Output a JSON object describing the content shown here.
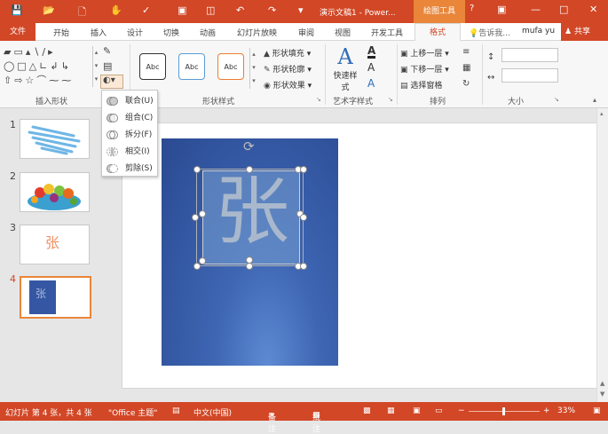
{
  "titlebar": {
    "title": "演示文稿1 - Power...",
    "contextual_tab": "绘图工具",
    "help": "?"
  },
  "tabs": {
    "file": "文件",
    "items": [
      "开始",
      "插入",
      "设计",
      "切换",
      "动画",
      "幻灯片放映",
      "审阅",
      "视图",
      "开发工具"
    ],
    "active": "格式",
    "tell_me": "告诉我...",
    "user": "mufa yu",
    "share": "共享"
  },
  "ribbon": {
    "groups": {
      "insert_shapes": "插入形状",
      "shape_styles": "形状样式",
      "wordart": "艺术字样式",
      "arrange": "排列",
      "size": "大小"
    },
    "style_samples": [
      "Abc",
      "Abc",
      "Abc"
    ],
    "shape_fill": "形状填充",
    "shape_outline": "形状轮廓",
    "shape_effects": "形状效果",
    "quick_styles": "快速样式",
    "bring_forward": "上移一层",
    "send_backward": "下移一层",
    "selection_pane": "选择窗格",
    "wordart_letter": "A"
  },
  "merge_menu": {
    "items": [
      "联合(U)",
      "组合(C)",
      "拆分(F)",
      "相交(I)",
      "剪除(S)"
    ]
  },
  "slides": {
    "numbers": [
      "1",
      "2",
      "3",
      "4"
    ],
    "thumb3_char": "张",
    "thumb4_char": "张"
  },
  "slide": {
    "text": "张"
  },
  "statusbar": {
    "slide_info": "幻灯片 第 4 张，共 4 张",
    "theme": "\"Office 主题\"",
    "language": "中文(中国)",
    "notes": "备注",
    "comments": "批注",
    "zoom": "33%"
  },
  "colors": {
    "accent": "#d24726",
    "contextual": "#e9863a",
    "slide_blue": "#2a4a92"
  }
}
